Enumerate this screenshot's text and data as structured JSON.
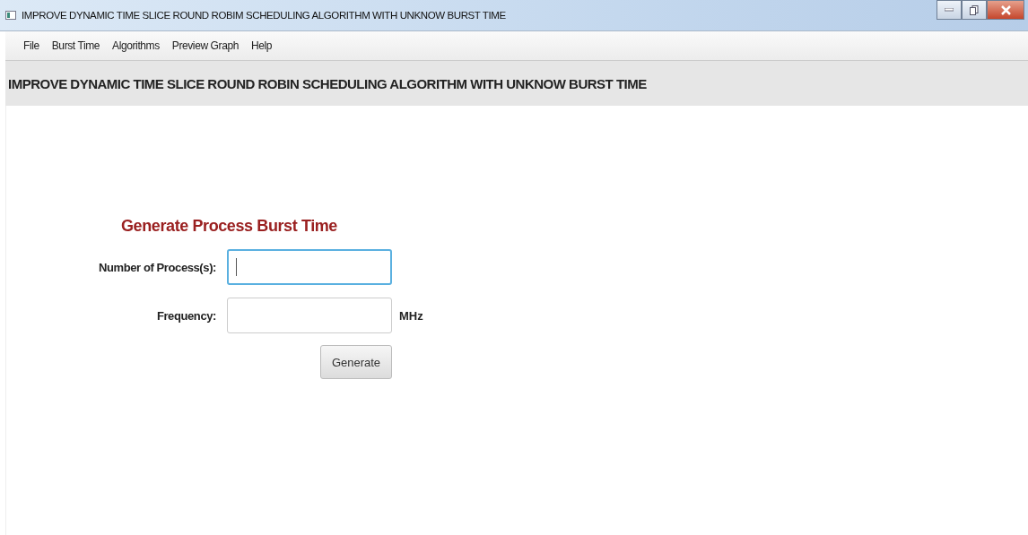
{
  "window": {
    "title": "IMPROVE DYNAMIC TIME SLICE ROUND ROBIM SCHEDULING ALGORITHM WITH UNKNOW BURST TIME"
  },
  "menu": [
    "File",
    "Burst Time",
    "Algorithms",
    "Preview Graph",
    "Help"
  ],
  "header": {
    "title": "IMPROVE DYNAMIC TIME SLICE ROUND ROBIN SCHEDULING ALGORITHM WITH UNKNOW BURST TIME"
  },
  "form": {
    "title": "Generate Process Burst Time",
    "fields": [
      {
        "label": "Number of Process(s):",
        "focused": true
      },
      {
        "label": "Frequency:",
        "focused": false,
        "unit": "MHz"
      }
    ],
    "button": "Generate"
  }
}
